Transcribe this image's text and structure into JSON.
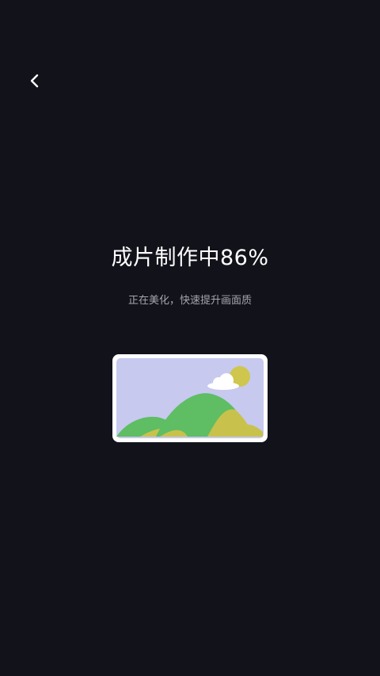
{
  "status": {
    "title_prefix": "成片制作中",
    "progress": "86%",
    "subtitle": "正在美化，快速提升画面质"
  },
  "colors": {
    "background": "#12121b",
    "text_primary": "#ffffff",
    "text_secondary": "#a6a6ad",
    "frame": "#ffffff",
    "sky": "#c7c9ef",
    "sun": "#cfc64d",
    "hill_green": "#5fbd64",
    "hill_yellow": "#c8c24c"
  },
  "icons": {
    "back": "chevron-left-icon",
    "illustration": "image-placeholder-icon"
  }
}
